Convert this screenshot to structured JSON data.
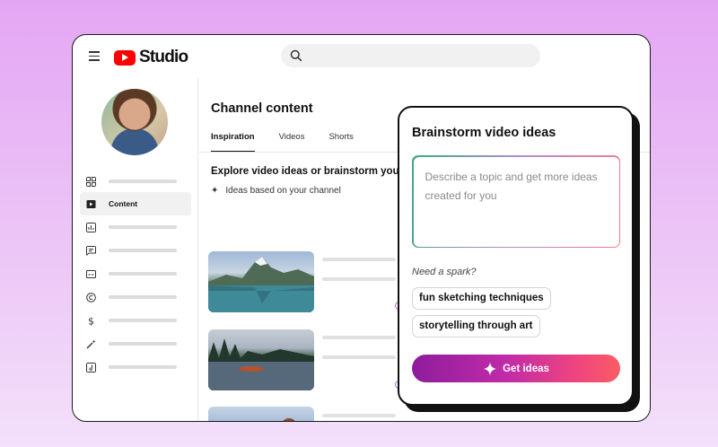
{
  "app": {
    "brand": "Studio"
  },
  "search": {
    "placeholder": ""
  },
  "sidebar": {
    "items": [
      {
        "icon": "dashboard-icon",
        "label": ""
      },
      {
        "icon": "content-icon",
        "label": "Content",
        "active": true
      },
      {
        "icon": "analytics-icon",
        "label": ""
      },
      {
        "icon": "comments-icon",
        "label": ""
      },
      {
        "icon": "subtitles-icon",
        "label": ""
      },
      {
        "icon": "copyright-icon",
        "label": ""
      },
      {
        "icon": "earn-icon",
        "label": ""
      },
      {
        "icon": "customization-icon",
        "label": ""
      },
      {
        "icon": "audio-library-icon",
        "label": ""
      }
    ]
  },
  "main": {
    "title": "Channel content",
    "tabs": [
      {
        "label": "Inspiration",
        "active": true
      },
      {
        "label": "Videos"
      },
      {
        "label": "Shorts"
      }
    ],
    "explore_heading": "Explore video ideas or brainstorm you",
    "ideas_channel": "Ideas based on your channel"
  },
  "brainstorm": {
    "title": "Brainstorm video ideas",
    "input_placeholder": "Describe a topic and get more ideas created for you",
    "spark_label": "Need a spark?",
    "chips": [
      "fun sketching techniques",
      "storytelling through art"
    ],
    "button_label": "Get ideas"
  },
  "colors": {
    "brand_red": "#ff0000",
    "gradient_start": "#8e1d9c",
    "gradient_end": "#f85d63",
    "accent_purple": "#b56ad9"
  }
}
